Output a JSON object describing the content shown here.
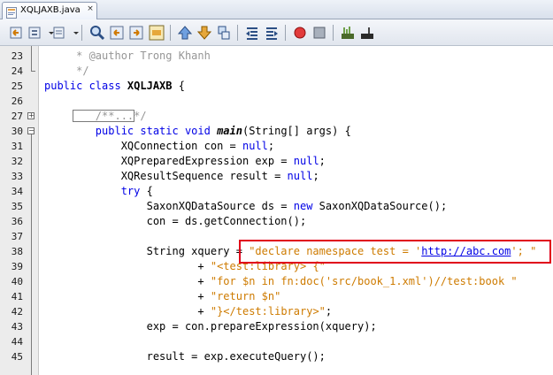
{
  "tab": {
    "label": "XQLJAXB.java",
    "close": "×"
  },
  "toolbar": {
    "buttons": [
      "back-icon",
      "forward-icon",
      "find-icon",
      "find-previous-icon",
      "find-next-icon",
      "toggle-highlight-icon",
      "previous-bookmark-icon",
      "next-bookmark-icon",
      "toggle-bookmark-icon",
      "shift-left-icon",
      "shift-right-icon",
      "start-macro-icon",
      "stop-macro-icon",
      "comment-icon",
      "uncomment-icon"
    ]
  },
  "editor": {
    "lines": [
      {
        "n": "23",
        "parts": [
          {
            "c": "cm",
            "t": "     * @author Trong Khanh"
          }
        ]
      },
      {
        "n": "24",
        "parts": [
          {
            "c": "cm",
            "t": "     */"
          }
        ]
      },
      {
        "n": "25",
        "parts": [
          {
            "c": "kw",
            "t": "public class "
          },
          {
            "c": "bold",
            "t": "XQLJAXB"
          },
          {
            "c": "",
            "t": " {"
          }
        ]
      },
      {
        "n": "26",
        "parts": []
      },
      {
        "n": "27",
        "parts": [
          {
            "c": "cm",
            "t": "        /**...*/"
          }
        ]
      },
      {
        "n": "30",
        "parts": [
          {
            "c": "kw",
            "t": "        public static void "
          },
          {
            "c": "bolditalic",
            "t": "main"
          },
          {
            "c": "",
            "t": "(String[] args) {"
          }
        ]
      },
      {
        "n": "31",
        "parts": [
          {
            "c": "",
            "t": "            XQConnection con = "
          },
          {
            "c": "kw",
            "t": "null"
          },
          {
            "c": "",
            "t": ";"
          }
        ]
      },
      {
        "n": "32",
        "parts": [
          {
            "c": "",
            "t": "            XQPreparedExpression exp = "
          },
          {
            "c": "kw",
            "t": "null"
          },
          {
            "c": "",
            "t": ";"
          }
        ]
      },
      {
        "n": "33",
        "parts": [
          {
            "c": "",
            "t": "            XQResultSequence result = "
          },
          {
            "c": "kw",
            "t": "null"
          },
          {
            "c": "",
            "t": ";"
          }
        ]
      },
      {
        "n": "34",
        "parts": [
          {
            "c": "kw",
            "t": "            try"
          },
          {
            "c": "",
            "t": " {"
          }
        ]
      },
      {
        "n": "35",
        "parts": [
          {
            "c": "",
            "t": "                SaxonXQDataSource ds = "
          },
          {
            "c": "kw",
            "t": "new"
          },
          {
            "c": "",
            "t": " SaxonXQDataSource();"
          }
        ]
      },
      {
        "n": "36",
        "parts": [
          {
            "c": "",
            "t": "                con = ds.getConnection();"
          }
        ]
      },
      {
        "n": "37",
        "parts": []
      },
      {
        "n": "38",
        "parts": [
          {
            "c": "",
            "t": "                String xquery = "
          },
          {
            "c": "str",
            "t": "\"declare namespace test = '"
          },
          {
            "c": "link",
            "t": "http://abc.com"
          },
          {
            "c": "str",
            "t": "'; \""
          }
        ]
      },
      {
        "n": "39",
        "parts": [
          {
            "c": "",
            "t": "                        + "
          },
          {
            "c": "str",
            "t": "\"<test:library> {\""
          }
        ]
      },
      {
        "n": "40",
        "parts": [
          {
            "c": "",
            "t": "                        + "
          },
          {
            "c": "str",
            "t": "\"for $n in fn:doc('src/book_1.xml')//test:book \""
          }
        ]
      },
      {
        "n": "41",
        "parts": [
          {
            "c": "",
            "t": "                        + "
          },
          {
            "c": "str",
            "t": "\"return $n\""
          }
        ]
      },
      {
        "n": "42",
        "parts": [
          {
            "c": "",
            "t": "                        + "
          },
          {
            "c": "str",
            "t": "\"}</test:library>\""
          },
          {
            "c": "",
            "t": ";"
          }
        ]
      },
      {
        "n": "43",
        "parts": [
          {
            "c": "",
            "t": "                exp = con.prepareExpression(xquery);"
          }
        ]
      },
      {
        "n": "44",
        "parts": []
      },
      {
        "n": "45",
        "parts": [
          {
            "c": "",
            "t": "                result = exp.executeQuery();"
          }
        ]
      }
    ]
  }
}
